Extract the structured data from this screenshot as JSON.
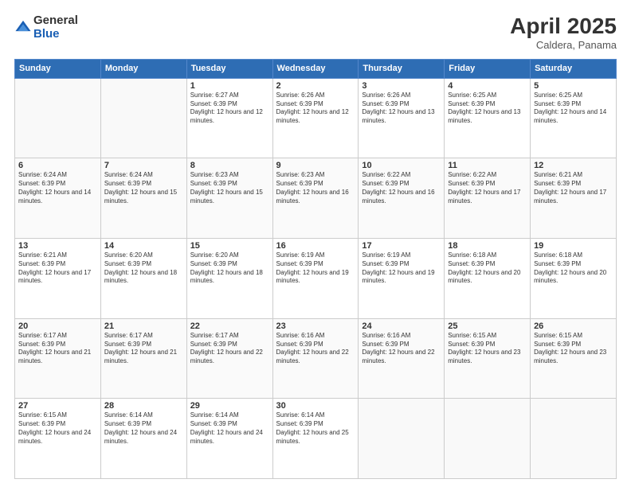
{
  "header": {
    "logo_general": "General",
    "logo_blue": "Blue",
    "month_title": "April 2025",
    "location": "Caldera, Panama"
  },
  "days_of_week": [
    "Sunday",
    "Monday",
    "Tuesday",
    "Wednesday",
    "Thursday",
    "Friday",
    "Saturday"
  ],
  "weeks": [
    [
      {
        "day": "",
        "info": ""
      },
      {
        "day": "",
        "info": ""
      },
      {
        "day": "1",
        "info": "Sunrise: 6:27 AM\nSunset: 6:39 PM\nDaylight: 12 hours and 12 minutes."
      },
      {
        "day": "2",
        "info": "Sunrise: 6:26 AM\nSunset: 6:39 PM\nDaylight: 12 hours and 12 minutes."
      },
      {
        "day": "3",
        "info": "Sunrise: 6:26 AM\nSunset: 6:39 PM\nDaylight: 12 hours and 13 minutes."
      },
      {
        "day": "4",
        "info": "Sunrise: 6:25 AM\nSunset: 6:39 PM\nDaylight: 12 hours and 13 minutes."
      },
      {
        "day": "5",
        "info": "Sunrise: 6:25 AM\nSunset: 6:39 PM\nDaylight: 12 hours and 14 minutes."
      }
    ],
    [
      {
        "day": "6",
        "info": "Sunrise: 6:24 AM\nSunset: 6:39 PM\nDaylight: 12 hours and 14 minutes."
      },
      {
        "day": "7",
        "info": "Sunrise: 6:24 AM\nSunset: 6:39 PM\nDaylight: 12 hours and 15 minutes."
      },
      {
        "day": "8",
        "info": "Sunrise: 6:23 AM\nSunset: 6:39 PM\nDaylight: 12 hours and 15 minutes."
      },
      {
        "day": "9",
        "info": "Sunrise: 6:23 AM\nSunset: 6:39 PM\nDaylight: 12 hours and 16 minutes."
      },
      {
        "day": "10",
        "info": "Sunrise: 6:22 AM\nSunset: 6:39 PM\nDaylight: 12 hours and 16 minutes."
      },
      {
        "day": "11",
        "info": "Sunrise: 6:22 AM\nSunset: 6:39 PM\nDaylight: 12 hours and 17 minutes."
      },
      {
        "day": "12",
        "info": "Sunrise: 6:21 AM\nSunset: 6:39 PM\nDaylight: 12 hours and 17 minutes."
      }
    ],
    [
      {
        "day": "13",
        "info": "Sunrise: 6:21 AM\nSunset: 6:39 PM\nDaylight: 12 hours and 17 minutes."
      },
      {
        "day": "14",
        "info": "Sunrise: 6:20 AM\nSunset: 6:39 PM\nDaylight: 12 hours and 18 minutes."
      },
      {
        "day": "15",
        "info": "Sunrise: 6:20 AM\nSunset: 6:39 PM\nDaylight: 12 hours and 18 minutes."
      },
      {
        "day": "16",
        "info": "Sunrise: 6:19 AM\nSunset: 6:39 PM\nDaylight: 12 hours and 19 minutes."
      },
      {
        "day": "17",
        "info": "Sunrise: 6:19 AM\nSunset: 6:39 PM\nDaylight: 12 hours and 19 minutes."
      },
      {
        "day": "18",
        "info": "Sunrise: 6:18 AM\nSunset: 6:39 PM\nDaylight: 12 hours and 20 minutes."
      },
      {
        "day": "19",
        "info": "Sunrise: 6:18 AM\nSunset: 6:39 PM\nDaylight: 12 hours and 20 minutes."
      }
    ],
    [
      {
        "day": "20",
        "info": "Sunrise: 6:17 AM\nSunset: 6:39 PM\nDaylight: 12 hours and 21 minutes."
      },
      {
        "day": "21",
        "info": "Sunrise: 6:17 AM\nSunset: 6:39 PM\nDaylight: 12 hours and 21 minutes."
      },
      {
        "day": "22",
        "info": "Sunrise: 6:17 AM\nSunset: 6:39 PM\nDaylight: 12 hours and 22 minutes."
      },
      {
        "day": "23",
        "info": "Sunrise: 6:16 AM\nSunset: 6:39 PM\nDaylight: 12 hours and 22 minutes."
      },
      {
        "day": "24",
        "info": "Sunrise: 6:16 AM\nSunset: 6:39 PM\nDaylight: 12 hours and 22 minutes."
      },
      {
        "day": "25",
        "info": "Sunrise: 6:15 AM\nSunset: 6:39 PM\nDaylight: 12 hours and 23 minutes."
      },
      {
        "day": "26",
        "info": "Sunrise: 6:15 AM\nSunset: 6:39 PM\nDaylight: 12 hours and 23 minutes."
      }
    ],
    [
      {
        "day": "27",
        "info": "Sunrise: 6:15 AM\nSunset: 6:39 PM\nDaylight: 12 hours and 24 minutes."
      },
      {
        "day": "28",
        "info": "Sunrise: 6:14 AM\nSunset: 6:39 PM\nDaylight: 12 hours and 24 minutes."
      },
      {
        "day": "29",
        "info": "Sunrise: 6:14 AM\nSunset: 6:39 PM\nDaylight: 12 hours and 24 minutes."
      },
      {
        "day": "30",
        "info": "Sunrise: 6:14 AM\nSunset: 6:39 PM\nDaylight: 12 hours and 25 minutes."
      },
      {
        "day": "",
        "info": ""
      },
      {
        "day": "",
        "info": ""
      },
      {
        "day": "",
        "info": ""
      }
    ]
  ]
}
